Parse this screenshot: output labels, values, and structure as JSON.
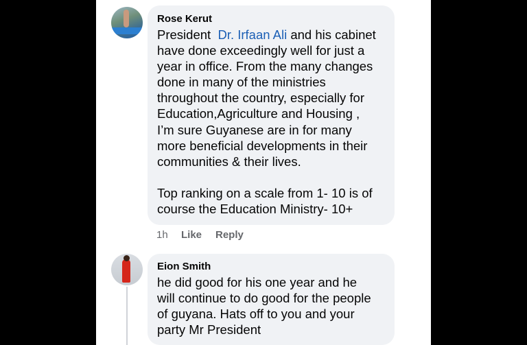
{
  "comments": [
    {
      "author": "Rose Kerut",
      "text_before_link": "President  ",
      "link_text": "Dr. Irfaan Ali",
      "text_after_link": " and his cabinet",
      "lines": [
        "have done exceedingly well for just a",
        "year in office. From the many changes",
        "done in many of the ministries",
        "throughout the country, especially for",
        "Education,Agriculture and Housing ,",
        "I’m sure Guyanese are in for many",
        "more beneficial developments in their",
        "communities & their lives.",
        "",
        "Top ranking on a scale from 1- 10 is of",
        "course the Education Ministry- 10+"
      ],
      "time": "1h",
      "like_label": "Like",
      "reply_label": "Reply"
    },
    {
      "author": "Eion Smith",
      "lines": [
        "he did good for his one year and he",
        "will continue to do good for the people",
        "of guyana. Hats off to you and your",
        "party Mr President"
      ]
    }
  ],
  "colors": {
    "link": "#1b5fb5",
    "bubble": "#f0f2f5",
    "meta": "#65676b"
  }
}
